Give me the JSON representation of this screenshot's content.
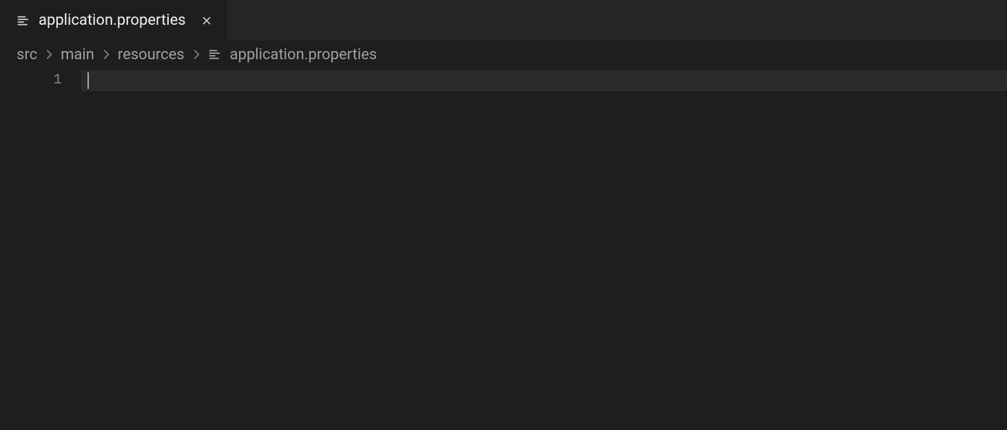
{
  "tab": {
    "label": "application.properties"
  },
  "breadcrumb": {
    "segments": [
      {
        "label": "src"
      },
      {
        "label": "main"
      },
      {
        "label": "resources"
      }
    ],
    "file": "application.properties"
  },
  "editor": {
    "line_numbers": [
      "1"
    ],
    "content": ""
  }
}
